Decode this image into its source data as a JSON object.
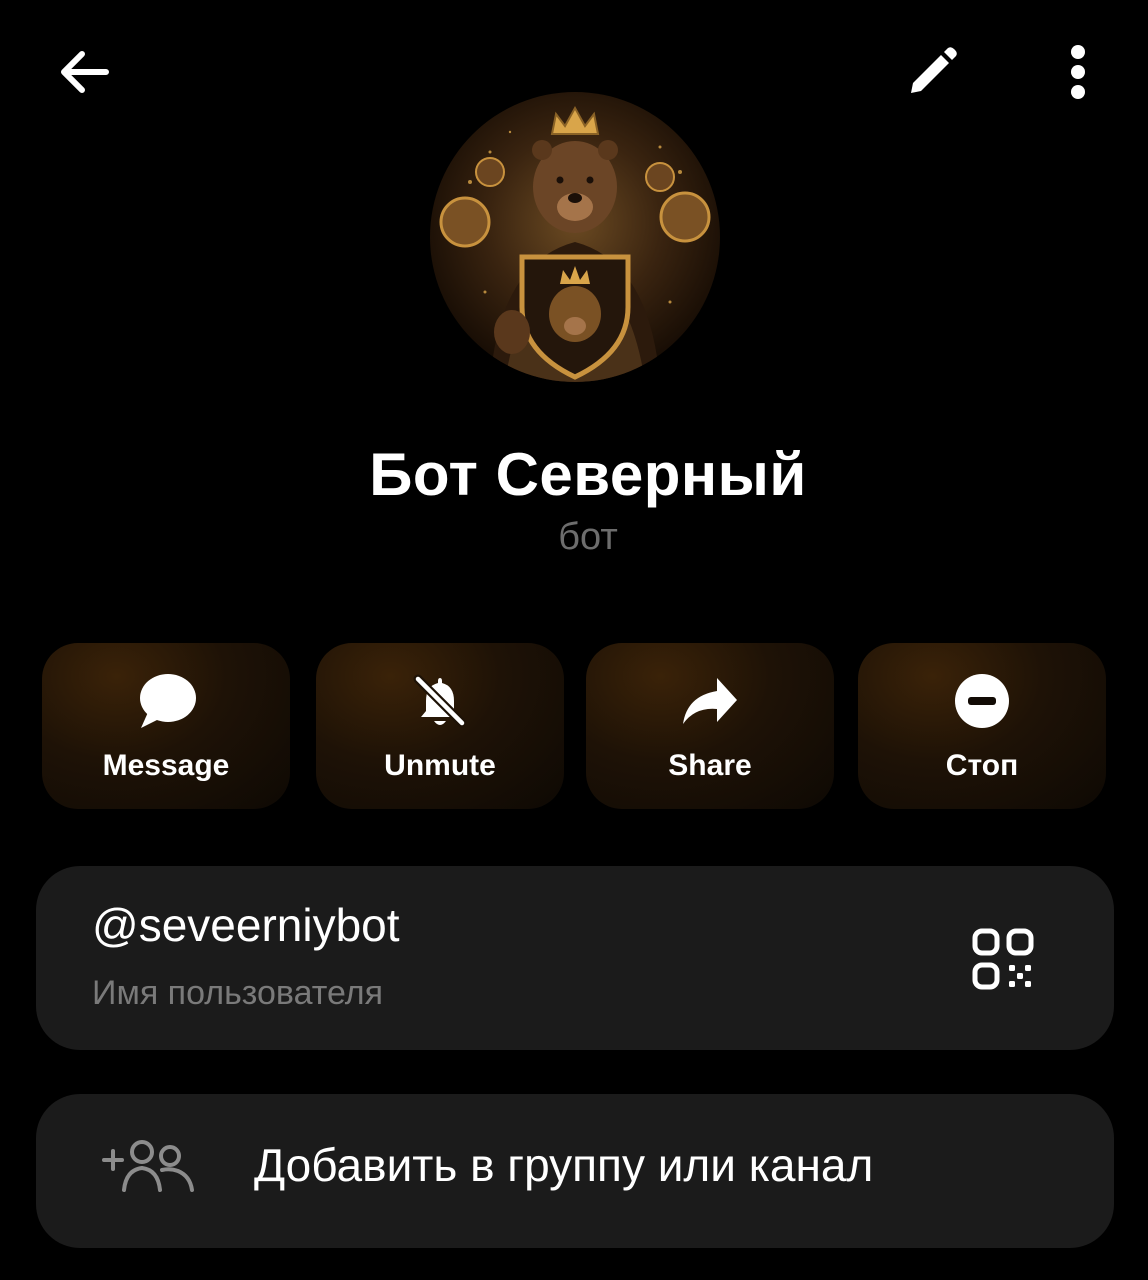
{
  "header": {
    "back_icon": "arrow-back-icon",
    "edit_icon": "pencil-icon",
    "more_icon": "more-vertical-icon"
  },
  "profile": {
    "avatar": "bear-king-avatar",
    "name": "Бот Северный",
    "subtitle": "бот"
  },
  "actions": [
    {
      "label": "Message",
      "icon": "chat-bubble-icon"
    },
    {
      "label": "Unmute",
      "icon": "bell-off-icon"
    },
    {
      "label": "Share",
      "icon": "share-arrow-icon"
    },
    {
      "label": "Стоп",
      "icon": "stop-circle-icon"
    }
  ],
  "username": {
    "value": "@seveerniybot",
    "caption": "Имя пользователя",
    "qr_icon": "qr-code-icon"
  },
  "add_to_group": {
    "label": "Добавить в группу или канал",
    "icon": "add-group-icon"
  },
  "colors": {
    "background": "#000000",
    "card": "#1b1b1b",
    "action_accent": "#3a2208",
    "secondary_text": "#7a7a7a"
  }
}
